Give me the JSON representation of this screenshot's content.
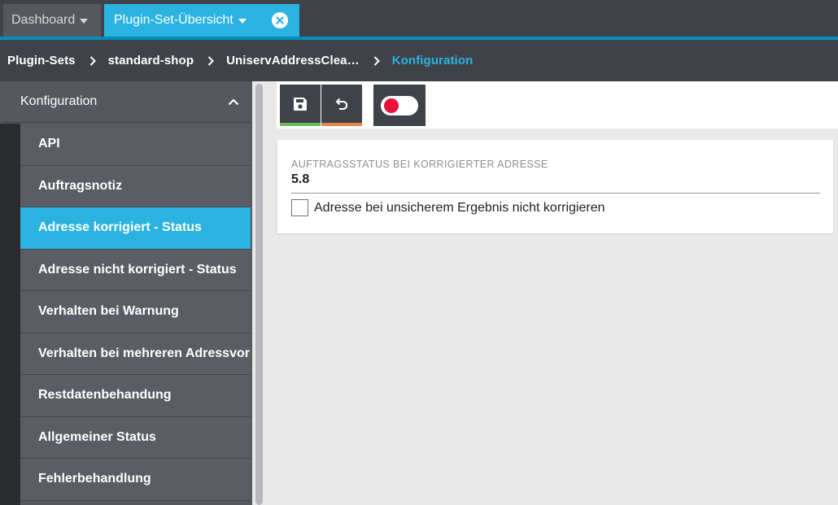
{
  "tabs": {
    "dashboard": "Dashboard",
    "active": "Plugin-Set-Übersicht"
  },
  "breadcrumb": [
    "Plugin-Sets",
    "standard-shop",
    "UniservAddressClea…",
    "Konfiguration"
  ],
  "sidebar": {
    "header": "Konfiguration",
    "items": [
      "API",
      "Auftragsnotiz",
      "Adresse korrigiert - Status",
      "Adresse nicht korrigiert - Status",
      "Verhalten bei Warnung",
      "Verhalten bei mehreren Adressvorschlägen",
      "Restdatenbehandung",
      "Allgemeiner Status",
      "Fehlerbehandlung"
    ],
    "active_index": 2
  },
  "form": {
    "field_label": "AUFTRAGSSTATUS BEI KORRIGIERTER ADRESSE",
    "field_value": "5.8",
    "checkbox_label": "Adresse bei unsicherem Ergebnis nicht korrigieren",
    "checkbox_checked": false
  },
  "icons": {
    "save": "save-icon",
    "reset": "undo-icon",
    "toggle": "toggle-icon",
    "close": "close-icon",
    "collapse": "chevron-up-icon"
  },
  "colors": {
    "accent": "#2ab3e0",
    "dark": "#3f4248",
    "save_bar": "#6bbb5a",
    "reset_bar": "#e8854a",
    "toggle_knob": "#e8123a"
  }
}
